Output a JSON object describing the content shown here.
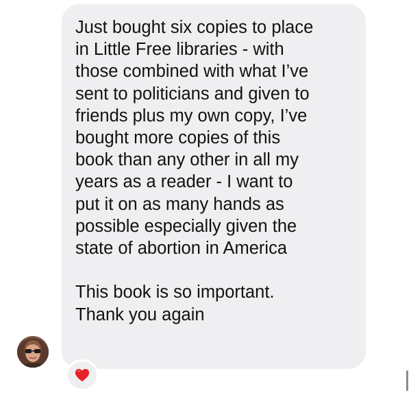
{
  "message": {
    "text": "Just bought six copies to place\nin Little Free libraries - with\nthose combined with what I’ve\nsent to politicians and given to\nfriends plus my own copy, I’ve\nbought more copies of this\nbook than any other in all my\nyears as a reader - I want to\nput it on as many hands as\npossible especially given the\nstate of abortion in America\n\nThis book is so important.\nThank you again",
    "reaction_icon": "red-heart-icon",
    "bubble_color": "#efeff1",
    "reaction_color": "#e8202a"
  },
  "sender": {
    "avatar_icon": "avatar"
  }
}
